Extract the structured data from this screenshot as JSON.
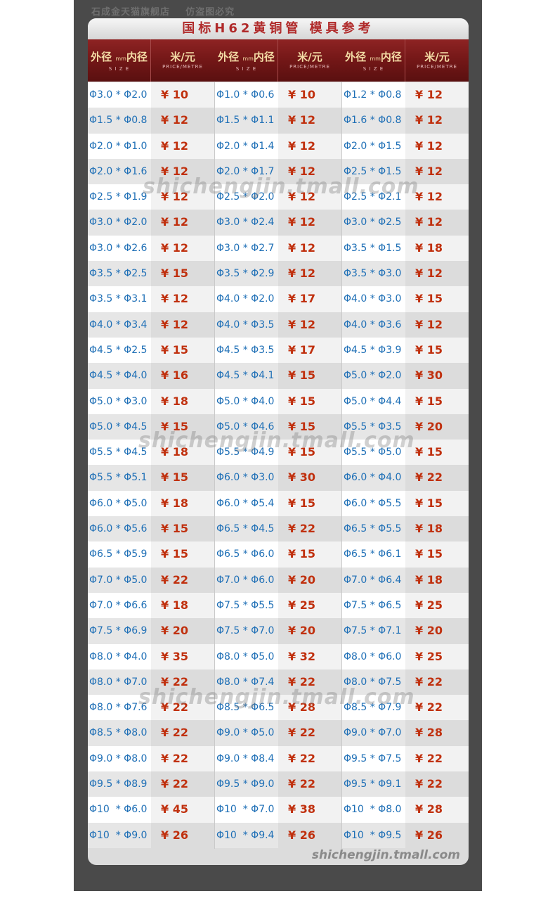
{
  "shop_label": "石成金天猫旗舰店    仿盗图必究",
  "title": "国标H62黄铜管 模具参考",
  "header": {
    "size_label": "外径",
    "size_unit": "mm",
    "size_label2": "内径",
    "size_sub": "S I Z E",
    "price_label": "米/元",
    "price_sub": "PRICE/METRE"
  },
  "columns": [
    [
      {
        "size": "Φ3.0 * Φ2.0",
        "price": "¥ 10"
      },
      {
        "size": "Φ1.5 * Φ0.8",
        "price": "¥ 12"
      },
      {
        "size": "Φ2.0 * Φ1.0",
        "price": "¥ 12"
      },
      {
        "size": "Φ2.0 * Φ1.6",
        "price": "¥ 12"
      },
      {
        "size": "Φ2.5 * Φ1.9",
        "price": "¥ 12"
      },
      {
        "size": "Φ3.0 * Φ2.0",
        "price": "¥ 12"
      },
      {
        "size": "Φ3.0 * Φ2.6",
        "price": "¥ 12"
      },
      {
        "size": "Φ3.5 * Φ2.5",
        "price": "¥ 15"
      },
      {
        "size": "Φ3.5 * Φ3.1",
        "price": "¥ 12"
      },
      {
        "size": "Φ4.0 * Φ3.4",
        "price": "¥ 12"
      },
      {
        "size": "Φ4.5 * Φ2.5",
        "price": "¥ 15"
      },
      {
        "size": "Φ4.5 * Φ4.0",
        "price": "¥ 16"
      },
      {
        "size": "Φ5.0 * Φ3.0",
        "price": "¥ 18"
      },
      {
        "size": "Φ5.0 * Φ4.5",
        "price": "¥ 15"
      },
      {
        "size": "Φ5.5 * Φ4.5",
        "price": "¥ 18"
      },
      {
        "size": "Φ5.5 * Φ5.1",
        "price": "¥ 15"
      },
      {
        "size": "Φ6.0 * Φ5.0",
        "price": "¥ 18"
      },
      {
        "size": "Φ6.0 * Φ5.6",
        "price": "¥ 15"
      },
      {
        "size": "Φ6.5 * Φ5.9",
        "price": "¥ 15"
      },
      {
        "size": "Φ7.0 * Φ5.0",
        "price": "¥ 22"
      },
      {
        "size": "Φ7.0 * Φ6.6",
        "price": "¥ 18"
      },
      {
        "size": "Φ7.5 * Φ6.9",
        "price": "¥ 20"
      },
      {
        "size": "Φ8.0 * Φ4.0",
        "price": "¥ 35"
      },
      {
        "size": "Φ8.0 * Φ7.0",
        "price": "¥ 22"
      },
      {
        "size": "Φ8.0 * Φ7.6",
        "price": "¥ 22"
      },
      {
        "size": "Φ8.5 * Φ8.0",
        "price": "¥ 22"
      },
      {
        "size": "Φ9.0 * Φ8.0",
        "price": "¥ 22"
      },
      {
        "size": "Φ9.5 * Φ8.9",
        "price": "¥ 22"
      },
      {
        "size": "Φ10  * Φ6.0",
        "price": "¥ 45"
      },
      {
        "size": "Φ10  * Φ9.0",
        "price": "¥ 26"
      }
    ],
    [
      {
        "size": "Φ1.0 * Φ0.6",
        "price": "¥ 10"
      },
      {
        "size": "Φ1.5 * Φ1.1",
        "price": "¥ 12"
      },
      {
        "size": "Φ2.0 * Φ1.4",
        "price": "¥ 12"
      },
      {
        "size": "Φ2.0 * Φ1.7",
        "price": "¥ 12"
      },
      {
        "size": "Φ2.5 * Φ2.0",
        "price": "¥ 12"
      },
      {
        "size": "Φ3.0 * Φ2.4",
        "price": "¥ 12"
      },
      {
        "size": "Φ3.0 * Φ2.7",
        "price": "¥ 12"
      },
      {
        "size": "Φ3.5 * Φ2.9",
        "price": "¥ 12"
      },
      {
        "size": "Φ4.0 * Φ2.0",
        "price": "¥ 17"
      },
      {
        "size": "Φ4.0 * Φ3.5",
        "price": "¥ 12"
      },
      {
        "size": "Φ4.5 * Φ3.5",
        "price": "¥ 17"
      },
      {
        "size": "Φ4.5 * Φ4.1",
        "price": "¥ 15"
      },
      {
        "size": "Φ5.0 * Φ4.0",
        "price": "¥ 15"
      },
      {
        "size": "Φ5.0 * Φ4.6",
        "price": "¥ 15"
      },
      {
        "size": "Φ5.5 * Φ4.9",
        "price": "¥ 15"
      },
      {
        "size": "Φ6.0 * Φ3.0",
        "price": "¥ 30"
      },
      {
        "size": "Φ6.0 * Φ5.4",
        "price": "¥ 15"
      },
      {
        "size": "Φ6.5 * Φ4.5",
        "price": "¥ 22"
      },
      {
        "size": "Φ6.5 * Φ6.0",
        "price": "¥ 15"
      },
      {
        "size": "Φ7.0 * Φ6.0",
        "price": "¥ 20"
      },
      {
        "size": "Φ7.5 * Φ5.5",
        "price": "¥ 25"
      },
      {
        "size": "Φ7.5 * Φ7.0",
        "price": "¥ 20"
      },
      {
        "size": "Φ8.0 * Φ5.0",
        "price": "¥ 32"
      },
      {
        "size": "Φ8.0 * Φ7.4",
        "price": "¥ 22"
      },
      {
        "size": "Φ8.5 * Φ6.5",
        "price": "¥ 28"
      },
      {
        "size": "Φ9.0 * Φ5.0",
        "price": "¥ 22"
      },
      {
        "size": "Φ9.0 * Φ8.4",
        "price": "¥ 22"
      },
      {
        "size": "Φ9.5 * Φ9.0",
        "price": "¥ 22"
      },
      {
        "size": "Φ10  * Φ7.0",
        "price": "¥ 38"
      },
      {
        "size": "Φ10  * Φ9.4",
        "price": "¥ 26"
      }
    ],
    [
      {
        "size": "Φ1.2 * Φ0.8",
        "price": "¥ 12"
      },
      {
        "size": "Φ1.6 * Φ0.8",
        "price": "¥ 12"
      },
      {
        "size": "Φ2.0 * Φ1.5",
        "price": "¥ 12"
      },
      {
        "size": "Φ2.5 * Φ1.5",
        "price": "¥ 12"
      },
      {
        "size": "Φ2.5 * Φ2.1",
        "price": "¥ 12"
      },
      {
        "size": "Φ3.0 * Φ2.5",
        "price": "¥ 12"
      },
      {
        "size": "Φ3.5 * Φ1.5",
        "price": "¥ 18"
      },
      {
        "size": "Φ3.5 * Φ3.0",
        "price": "¥ 12"
      },
      {
        "size": "Φ4.0 * Φ3.0",
        "price": "¥ 15"
      },
      {
        "size": "Φ4.0 * Φ3.6",
        "price": "¥ 12"
      },
      {
        "size": "Φ4.5 * Φ3.9",
        "price": "¥ 15"
      },
      {
        "size": "Φ5.0 * Φ2.0",
        "price": "¥ 30"
      },
      {
        "size": "Φ5.0 * Φ4.4",
        "price": "¥ 15"
      },
      {
        "size": "Φ5.5 * Φ3.5",
        "price": "¥ 20"
      },
      {
        "size": "Φ5.5 * Φ5.0",
        "price": "¥ 15"
      },
      {
        "size": "Φ6.0 * Φ4.0",
        "price": "¥ 22"
      },
      {
        "size": "Φ6.0 * Φ5.5",
        "price": "¥ 15"
      },
      {
        "size": "Φ6.5 * Φ5.5",
        "price": "¥ 18"
      },
      {
        "size": "Φ6.5 * Φ6.1",
        "price": "¥ 15"
      },
      {
        "size": "Φ7.0 * Φ6.4",
        "price": "¥ 18"
      },
      {
        "size": "Φ7.5 * Φ6.5",
        "price": "¥ 25"
      },
      {
        "size": "Φ7.5 * Φ7.1",
        "price": "¥ 20"
      },
      {
        "size": "Φ8.0 * Φ6.0",
        "price": "¥ 25"
      },
      {
        "size": "Φ8.0 * Φ7.5",
        "price": "¥ 22"
      },
      {
        "size": "Φ8.5 * Φ7.9",
        "price": "¥ 22"
      },
      {
        "size": "Φ9.0 * Φ7.0",
        "price": "¥ 28"
      },
      {
        "size": "Φ9.5 * Φ7.5",
        "price": "¥ 22"
      },
      {
        "size": "Φ9.5 * Φ9.1",
        "price": "¥ 22"
      },
      {
        "size": "Φ10  * Φ8.0",
        "price": "¥ 28"
      },
      {
        "size": "Φ10  * Φ9.5",
        "price": "¥ 26"
      }
    ]
  ],
  "watermark": "shichengjin.tmall.com",
  "colors": {
    "size_text": "#1e6fb6",
    "price_text": "#c0300e",
    "header_bg": "#7a1a1a",
    "title_text": "#b02a2a"
  }
}
